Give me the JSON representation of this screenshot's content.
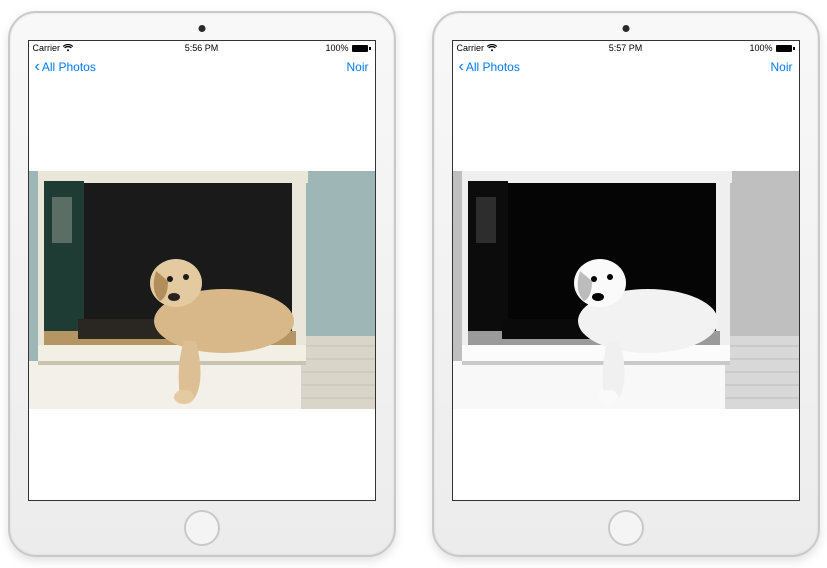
{
  "devices": [
    {
      "statusbar": {
        "carrier": "Carrier",
        "time": "5:56 PM",
        "battery": "100%"
      },
      "navbar": {
        "back_label": "All Photos",
        "action_label": "Noir"
      },
      "photo_style": "color"
    },
    {
      "statusbar": {
        "carrier": "Carrier",
        "time": "5:57 PM",
        "battery": "100%"
      },
      "navbar": {
        "back_label": "All Photos",
        "action_label": "Noir"
      },
      "photo_style": "noir"
    }
  ]
}
